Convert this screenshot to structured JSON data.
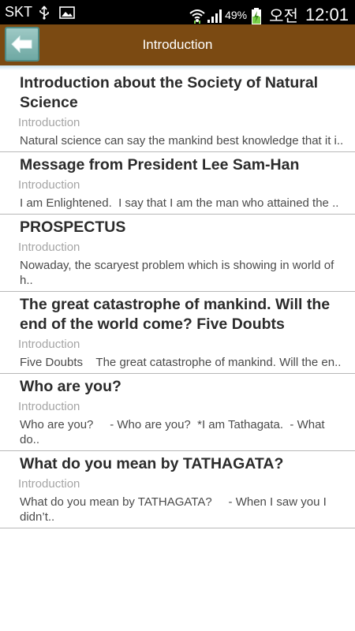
{
  "status_bar": {
    "carrier": "SKT",
    "battery": "49%",
    "ampm": "오전",
    "time": "12:01",
    "icons": [
      "usb-icon",
      "image-icon",
      "wifi-icon",
      "signal-icon",
      "battery-icon"
    ]
  },
  "header": {
    "title": "Introduction",
    "back_icon": "back-arrow-icon",
    "bar_color": "#7b4a12"
  },
  "items": [
    {
      "title": "Introduction about the Society of Natural Science",
      "category": "Introduction",
      "snippet": "Natural science can say the mankind best knowledge that it i.."
    },
    {
      "title": "Message from President Lee Sam-Han",
      "category": "Introduction",
      "snippet": "I am Enlightened.  I say that I am the man who attained the .."
    },
    {
      "title": "PROSPECTUS",
      "category": "Introduction",
      "snippet": "Nowaday, the scaryest problem which is showing in world of h.."
    },
    {
      "title": "The great catastrophe of mankind. Will the end of the world come? Five Doubts",
      "category": "Introduction",
      "snippet": "Five Doubts    The great catastrophe of mankind. Will the en.."
    },
    {
      "title": "Who are you?",
      "category": "Introduction",
      "snippet": "Who are you?     - Who are you?  *I am Tathagata.  - What do.."
    },
    {
      "title": "What do you mean by TATHAGATA?",
      "category": "Introduction",
      "snippet": "What do you mean by TATHAGATA?     - When I saw you I didn’t.."
    }
  ]
}
